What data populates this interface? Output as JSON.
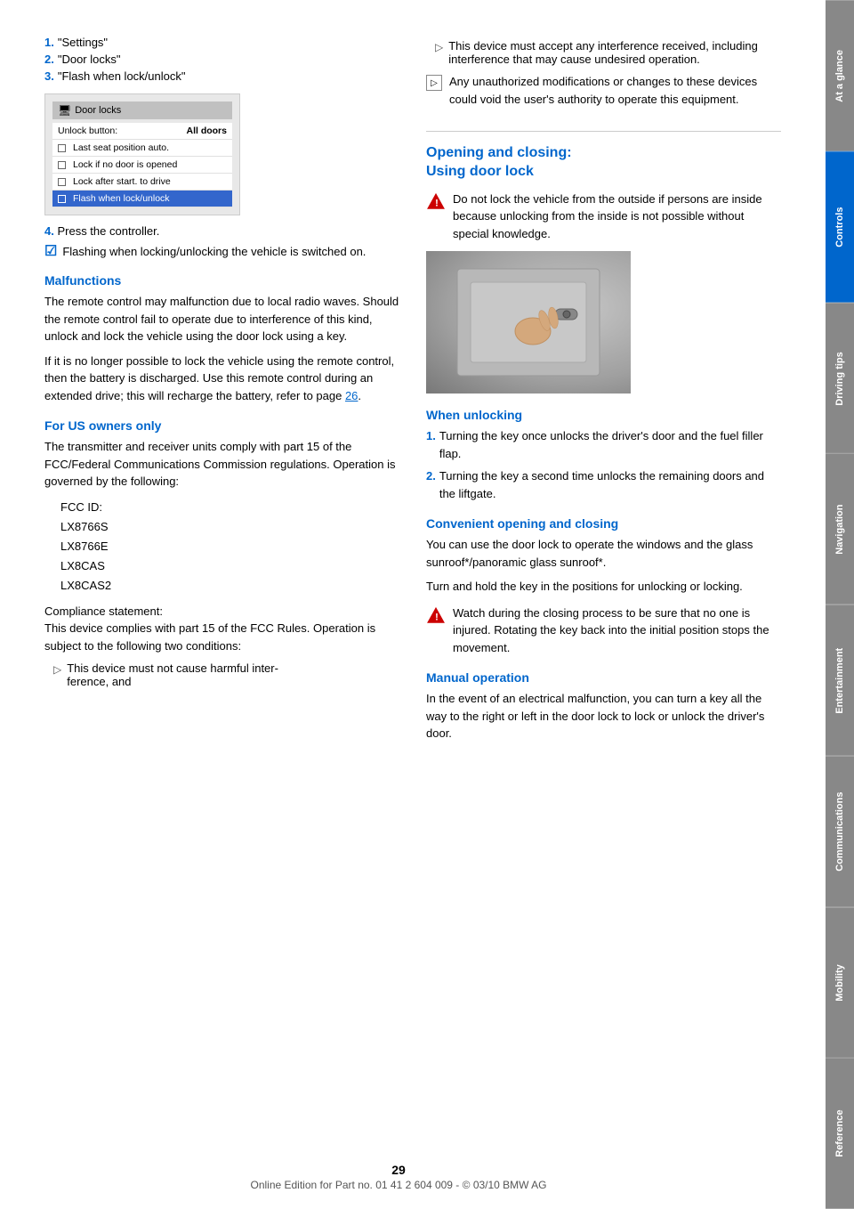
{
  "tabs": [
    {
      "id": "at-a-glance",
      "label": "At a glance",
      "active": false
    },
    {
      "id": "controls",
      "label": "Controls",
      "active": true
    },
    {
      "id": "driving",
      "label": "Driving tips",
      "active": false
    },
    {
      "id": "navigation",
      "label": "Navigation",
      "active": false
    },
    {
      "id": "entertainment",
      "label": "Entertainment",
      "active": false
    },
    {
      "id": "communications",
      "label": "Communications",
      "active": false
    },
    {
      "id": "mobility",
      "label": "Mobility",
      "active": false
    },
    {
      "id": "reference",
      "label": "Reference",
      "active": false
    }
  ],
  "left_col": {
    "steps": [
      {
        "num": "1.",
        "text": "\"Settings\""
      },
      {
        "num": "2.",
        "text": "\"Door locks\""
      },
      {
        "num": "3.",
        "text": "\"Flash when lock/unlock\""
      }
    ],
    "screen": {
      "header": "Door locks",
      "unlock_label": "Unlock button:",
      "unlock_value": "All doors",
      "rows": [
        {
          "text": "Last seat position auto.",
          "checked": false
        },
        {
          "text": "Lock if no door is opened",
          "checked": false
        },
        {
          "text": "Lock after start. to drive",
          "checked": false
        },
        {
          "text": "Flash when lock/unlock",
          "checked": false,
          "highlighted": true
        }
      ]
    },
    "step4": "4.",
    "step4_text": "Press the controller.",
    "step4_note": "Flashing when locking/unlocking the vehicle is switched on.",
    "malfunctions": {
      "heading": "Malfunctions",
      "para1": "The remote control may malfunction due to local radio waves. Should the remote control fail to operate due to interference of this kind, unlock and lock the vehicle using the door lock using a key.",
      "para2_pre": "If it is no longer possible to lock the vehicle using the remote control, then the battery is discharged. Use this remote control during an extended drive; this will recharge the battery, refer to page ",
      "para2_link": "26",
      "para2_post": "."
    },
    "for_us_owners": {
      "heading": "For US owners only",
      "para1": "The transmitter and receiver units comply with part 15 of the FCC/Federal Communications Commission regulations. Operation is governed by the following:",
      "fcc_ids": [
        "FCC ID:",
        "LX8766S",
        "LX8766E",
        "LX8CAS",
        "LX8CAS2"
      ],
      "compliance_heading": "Compliance statement:",
      "compliance_para": "This device complies with part 15 of the FCC Rules. Operation is subject to the following two conditions:",
      "bullet1_pre": "This device must not cause harmful inter-",
      "bullet1_post": "ference, and",
      "bullet2": "This device must accept any interference received, including interference that may cause undesired operation.",
      "info_text": "Any unauthorized modifications or changes to these devices could void the user's authority to operate this equipment."
    }
  },
  "right_col": {
    "opening_closing": {
      "heading_line1": "Opening and closing:",
      "heading_line2": "Using door lock",
      "warning": "Do not lock the vehicle from the outside if persons are inside because unlocking from the inside is not possible without special knowledge."
    },
    "when_unlocking": {
      "heading": "When unlocking",
      "steps": [
        {
          "num": "1.",
          "text": "Turning the key once unlocks the driver's door and the fuel filler flap."
        },
        {
          "num": "2.",
          "text": "Turning the key a second time unlocks the remaining doors and the liftgate."
        }
      ]
    },
    "convenient": {
      "heading": "Convenient opening and closing",
      "para1": "You can use the door lock to operate the windows and the glass sunroof*/panoramic glass sunroof*.",
      "para2": "Turn and hold the key in the positions for unlocking or locking.",
      "warning": "Watch during the closing process to be sure that no one is injured. Rotating the key back into the initial position stops the movement."
    },
    "manual_operation": {
      "heading": "Manual operation",
      "para": "In the event of an electrical malfunction, you can turn a key all the way to the right or left in the door lock to lock or unlock the driver's door."
    }
  },
  "footer": {
    "page_number": "29",
    "footer_text": "Online Edition for Part no. 01 41 2 604 009 - © 03/10 BMW AG"
  }
}
